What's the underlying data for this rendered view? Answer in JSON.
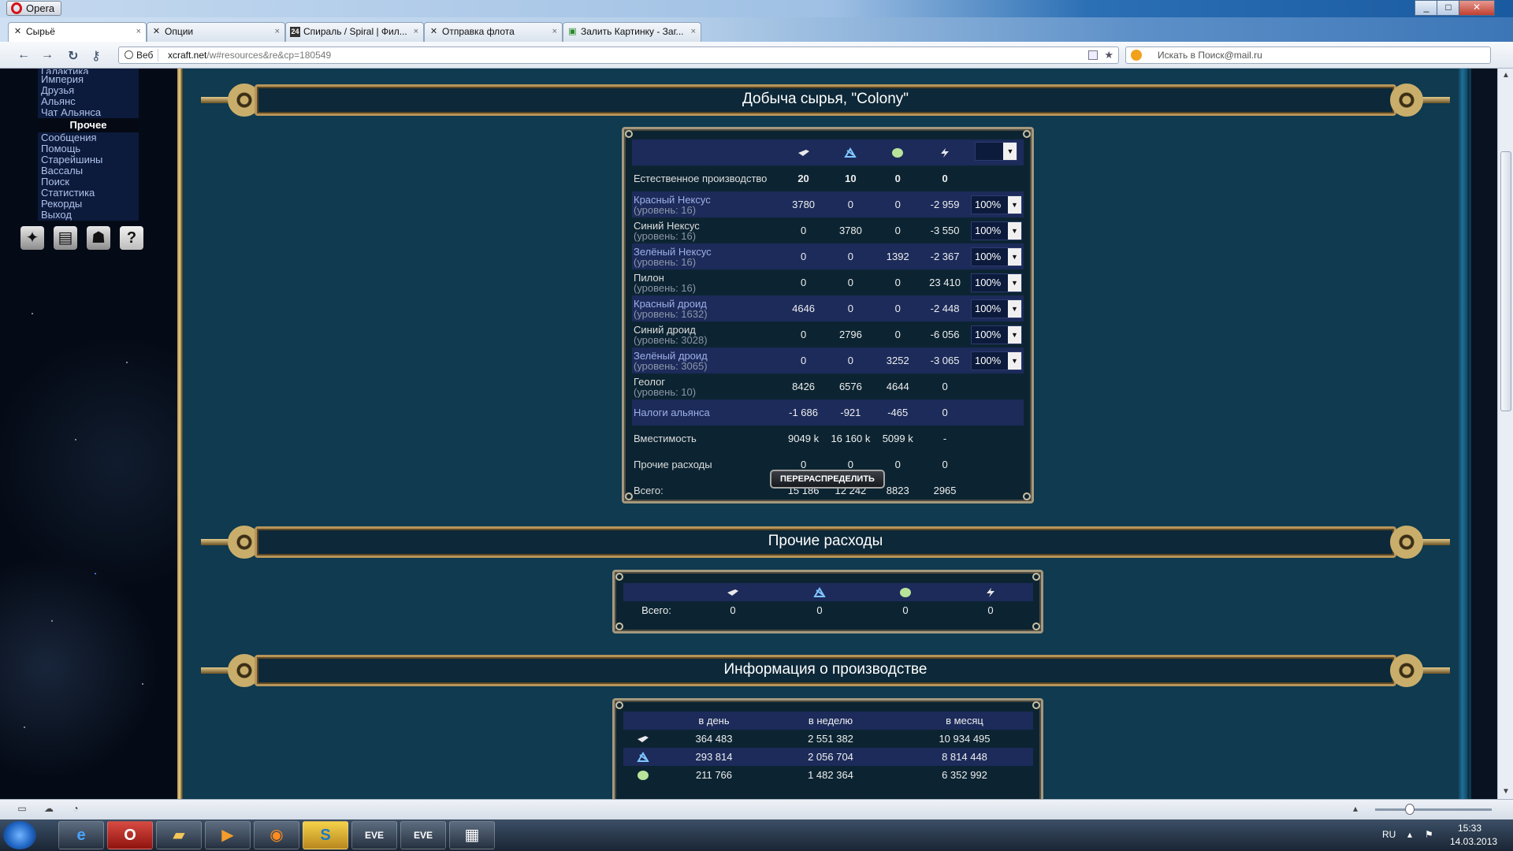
{
  "browser": {
    "app_name": "Opera",
    "window_controls": [
      "_",
      "□",
      "✕"
    ],
    "tabs": [
      {
        "label": "Сырьё",
        "icon": "✕",
        "close": "×"
      },
      {
        "label": "Опции",
        "icon": "✕",
        "close": "×"
      },
      {
        "label": "Спираль / Spiral | Фил...",
        "icon": "24",
        "close": "×"
      },
      {
        "label": "Отправка флота",
        "icon": "✕",
        "close": "×"
      },
      {
        "label": "Залить Картинку - Заг...",
        "icon": "▣",
        "close": "×"
      }
    ],
    "add_tab": "+",
    "address": {
      "badge": "Веб",
      "host": "xcraft.net",
      "path": "/w#resources&re&cp=180549"
    },
    "search_placeholder": "Искать в Поиск@mail.ru"
  },
  "left_menu": {
    "top_cut": "Галактика",
    "group1": [
      "Империя",
      "Друзья",
      "Альянс",
      "Чат Альянса"
    ],
    "header": "Прочее",
    "group2": [
      "Сообщения",
      "Помощь",
      "Старейшины",
      "Вассалы",
      "Поиск",
      "Статистика",
      "Рекорды",
      "Выход"
    ],
    "icons": [
      "alliance-icon",
      "book-icon",
      "officer-icon",
      "help-icon"
    ],
    "help_glyph": "?"
  },
  "production": {
    "title": "Добыча сырья, \"Colony\"",
    "resource_icons": [
      "metal-icon",
      "crystal-icon",
      "deuterium-icon",
      "energy-icon"
    ],
    "colors": {
      "orange": "#e6a12b",
      "blue": "#4ba9f7",
      "green": "#44d640",
      "yellow": "#f6e223",
      "red": "#e0202d"
    },
    "rows": [
      {
        "name": "Естественное производство",
        "sub": "",
        "values": [
          "20",
          "10",
          "0",
          "0"
        ],
        "pct": "",
        "colors": [
          "o",
          "b",
          "g",
          "y"
        ],
        "alt": false,
        "bold": true
      },
      {
        "name": "Красный Нексус",
        "sub": "(уровень: 16)",
        "values": [
          "3780",
          "0",
          "0",
          "-2 959"
        ],
        "pct": "100%",
        "colors": [
          "g",
          "b",
          "g",
          "r"
        ],
        "alt": true
      },
      {
        "name": "Синий Нексус",
        "sub": "(уровень: 16)",
        "values": [
          "0",
          "3780",
          "0",
          "-3 550"
        ],
        "pct": "100%",
        "colors": [
          "o",
          "g",
          "g",
          "r"
        ],
        "alt": false
      },
      {
        "name": "Зелёный Нексус",
        "sub": "(уровень: 16)",
        "values": [
          "0",
          "0",
          "1392",
          "-2 367"
        ],
        "pct": "100%",
        "colors": [
          "o",
          "b",
          "g",
          "r"
        ],
        "alt": true
      },
      {
        "name": "Пилон",
        "sub": "(уровень: 16)",
        "values": [
          "0",
          "0",
          "0",
          "23 410"
        ],
        "pct": "100%",
        "colors": [
          "o",
          "b",
          "g",
          "g"
        ],
        "alt": false
      },
      {
        "name": "Красный дроид",
        "sub": "(уровень: 1632)",
        "values": [
          "4646",
          "0",
          "0",
          "-2 448"
        ],
        "pct": "100%",
        "colors": [
          "g",
          "b",
          "g",
          "r"
        ],
        "alt": true
      },
      {
        "name": "Синий дроид",
        "sub": "(уровень: 3028)",
        "values": [
          "0",
          "2796",
          "0",
          "-6 056"
        ],
        "pct": "100%",
        "colors": [
          "o",
          "g",
          "g",
          "r"
        ],
        "alt": false
      },
      {
        "name": "Зелёный дроид",
        "sub": "(уровень: 3065)",
        "values": [
          "0",
          "0",
          "3252",
          "-3 065"
        ],
        "pct": "100%",
        "colors": [
          "o",
          "b",
          "g",
          "r"
        ],
        "alt": true
      },
      {
        "name": "Геолог",
        "sub": "(уровень: 10)",
        "values": [
          "8426",
          "6576",
          "4644",
          "0"
        ],
        "pct": "",
        "colors": [
          "g",
          "g",
          "g",
          "y"
        ],
        "alt": false
      },
      {
        "name": "Налоги альянса",
        "sub": "",
        "values": [
          "-1 686",
          "-921",
          "-465",
          "0"
        ],
        "pct": "",
        "colors": [
          "r",
          "r",
          "r",
          "y"
        ],
        "alt": true
      },
      {
        "name": "Вместимость",
        "sub": "",
        "values": [
          "9049 k",
          "16 160 k",
          "5099 k",
          "-"
        ],
        "pct": "",
        "colors": [
          "g",
          "g",
          "g",
          "g"
        ],
        "alt": false,
        "small": true
      },
      {
        "name": "Прочие расходы",
        "sub": "",
        "values": [
          "0",
          "0",
          "0",
          "0"
        ],
        "pct": "",
        "colors": [
          "wt",
          "wt",
          "wt",
          "wt"
        ],
        "alt": false,
        "small": true
      },
      {
        "name": "Всего:",
        "sub": "",
        "values": [
          "15 186",
          "12 242",
          "8823",
          "2965"
        ],
        "pct": "",
        "colors": [
          "g",
          "g",
          "g",
          "g"
        ],
        "alt": false,
        "small": true
      }
    ],
    "redistribute_label": "ПЕРЕРАСПРЕДЕЛИТЬ"
  },
  "other_expenses": {
    "title": "Прочие расходы",
    "total_label": "Всего:",
    "values": [
      "0",
      "0",
      "0",
      "0"
    ]
  },
  "production_info": {
    "title": "Информация о производстве",
    "columns": [
      "в день",
      "в неделю",
      "в месяц"
    ],
    "rows": [
      {
        "icon": "metal-icon",
        "values": [
          "364 483",
          "2 551 382",
          "10 934 495"
        ]
      },
      {
        "icon": "crystal-icon",
        "values": [
          "293 814",
          "2 056 704",
          "8 814 448"
        ]
      },
      {
        "icon": "deuterium-icon",
        "values": [
          "211 766",
          "1 482 364",
          "6 352 992"
        ]
      }
    ]
  },
  "tray": {
    "lang": "RU",
    "time": "15:33",
    "date": "14.03.2013"
  }
}
